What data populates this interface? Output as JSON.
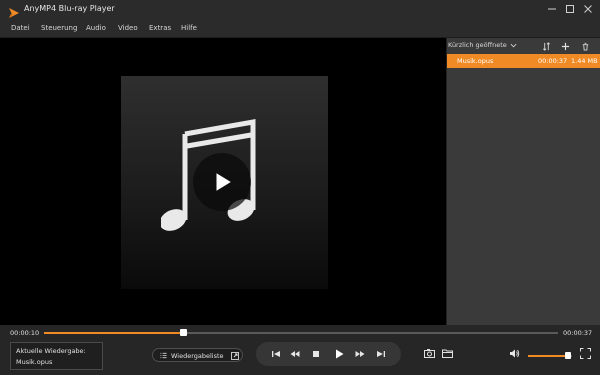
{
  "titlebar": {
    "title": "AnyMP4 Blu-ray Player",
    "icons": [
      "app-logo-icon",
      "minimize-icon",
      "maximize-icon",
      "close-icon"
    ]
  },
  "menu": {
    "items": [
      "Datei",
      "Steuerung",
      "Audio",
      "Video",
      "Extras",
      "Hilfe"
    ]
  },
  "player": {
    "cover_icon": "music-note-icon",
    "overlay_icon": "play-icon"
  },
  "playlist": {
    "header_label": "Kürzlich geöffnete",
    "header_icons": [
      "sort-icon",
      "add-icon",
      "delete-icon"
    ],
    "items": [
      {
        "name": "Musik.opus",
        "duration": "00:00:37",
        "size": "1.44 MB",
        "selected": true
      }
    ]
  },
  "controls": {
    "elapsed": "00:00:10",
    "total": "00:00:37",
    "progress": 0.27,
    "now_playing_label": "Aktuelle Wiedergabe:",
    "now_playing_file": "Musik.opus",
    "playlist_button_label": "Wiedergabeliste",
    "volume": 0.9
  },
  "colors": {
    "accent": "#f08a24",
    "background": "#1b1b1b",
    "panel": "#3a3a3a"
  }
}
